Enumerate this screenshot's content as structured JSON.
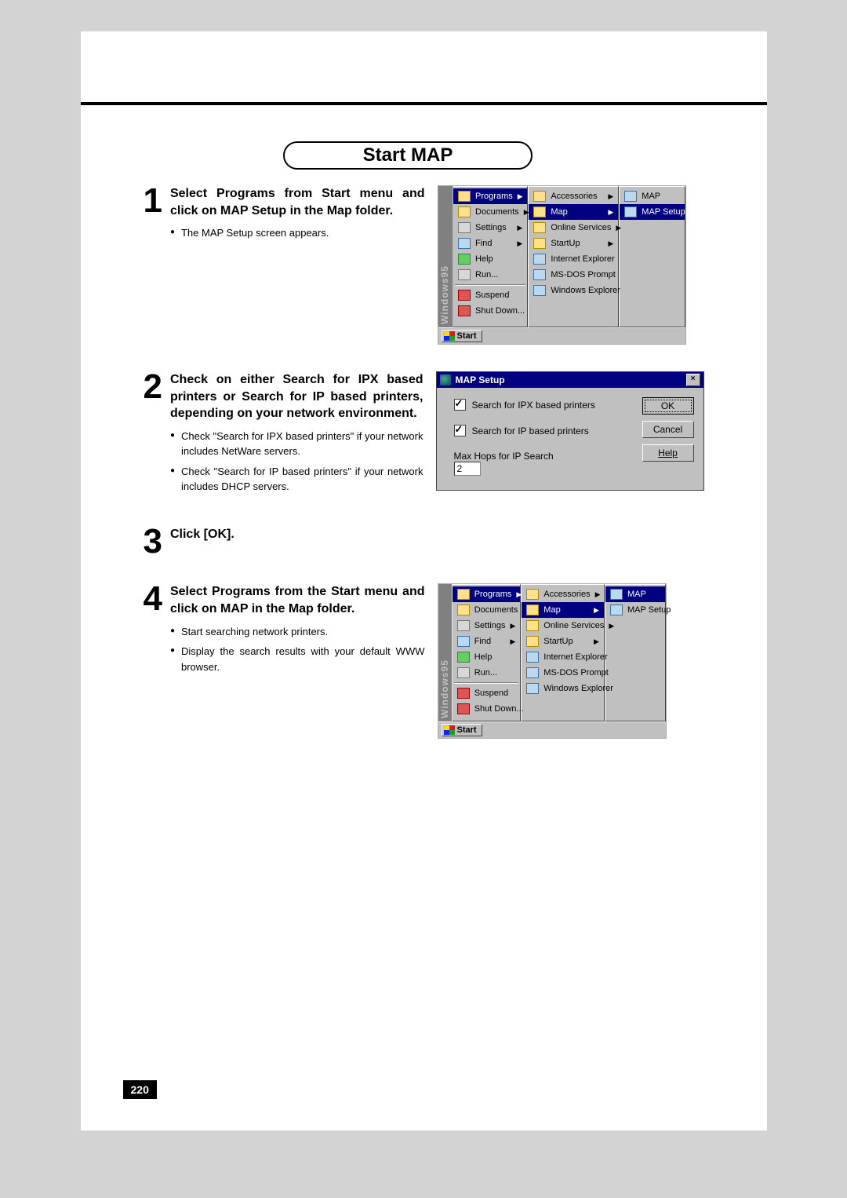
{
  "page_number": "220",
  "section_title": "Start MAP",
  "steps": [
    {
      "num": "1",
      "heading": "Select Programs from Start menu and click on MAP Setup in the Map folder.",
      "bullets": [
        "The MAP Setup screen appears."
      ]
    },
    {
      "num": "2",
      "heading": "Check on either Search for IPX based printers or Search for IP based printers, depending on your network environment.",
      "bullets": [
        "Check \"Search for IPX based printers\" if your network includes NetWare servers.",
        "Check \"Search for IP based printers\" if your network includes DHCP servers."
      ]
    },
    {
      "num": "3",
      "heading": "Click [OK].",
      "bullets": []
    },
    {
      "num": "4",
      "heading": "Select Programs from the Start menu and click on MAP in the Map folder.",
      "bullets": [
        "Start searching network printers.",
        "Display the search results with your default WWW browser."
      ]
    }
  ],
  "startmenu": {
    "side_label": "Windows95",
    "col1": [
      {
        "label": "Programs",
        "icon": "folder",
        "sel": true,
        "arrow": true
      },
      {
        "label": "Documents",
        "icon": "folder",
        "arrow": true
      },
      {
        "label": "Settings",
        "icon": "tool",
        "arrow": true
      },
      {
        "label": "Find",
        "icon": "app",
        "arrow": true
      },
      {
        "label": "Help",
        "icon": "green"
      },
      {
        "label": "Run...",
        "icon": "tool"
      },
      {
        "label": "Suspend",
        "icon": "red"
      },
      {
        "label": "Shut Down...",
        "icon": "red"
      }
    ],
    "col2": [
      {
        "label": "Accessories",
        "icon": "folder",
        "arrow": true
      },
      {
        "label": "Map",
        "icon": "folder",
        "sel": true,
        "arrow": true
      },
      {
        "label": "Online Services",
        "icon": "folder",
        "arrow": true
      },
      {
        "label": "StartUp",
        "icon": "folder",
        "arrow": true
      },
      {
        "label": "Internet Explorer",
        "icon": "app"
      },
      {
        "label": "MS-DOS Prompt",
        "icon": "app"
      },
      {
        "label": "Windows Explorer",
        "icon": "app"
      }
    ],
    "col3_setup": [
      {
        "label": "MAP",
        "icon": "app"
      },
      {
        "label": "MAP Setup",
        "icon": "app",
        "sel": true
      }
    ],
    "col3_map": [
      {
        "label": "MAP",
        "icon": "app",
        "sel": true
      },
      {
        "label": "MAP Setup",
        "icon": "app"
      }
    ],
    "start_btn": "Start"
  },
  "dialog": {
    "title": "MAP Setup",
    "opt_ipx": "Search for IPX based printers",
    "opt_ip": "Search for IP based printers",
    "max_hops_label": "Max Hops for IP Search",
    "max_hops_value": "2",
    "btn_ok": "OK",
    "btn_cancel": "Cancel",
    "btn_help": "Help"
  }
}
